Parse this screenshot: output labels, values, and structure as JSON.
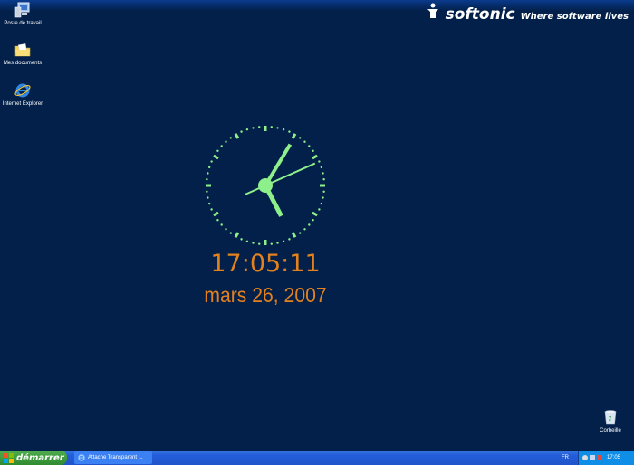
{
  "brand": {
    "name": "softonic",
    "slogan": "Where software lives"
  },
  "desktop_icons": [
    {
      "label": "Poste de travail",
      "icon": "computer-icon"
    },
    {
      "label": "Mes documents",
      "icon": "documents-folder-icon"
    },
    {
      "label": "Internet Explorer",
      "icon": "internet-explorer-icon"
    },
    {
      "label": "Corbeille",
      "icon": "recycle-bin-icon"
    }
  ],
  "clock": {
    "time": "17:05:11",
    "date": "mars 26, 2007",
    "hour": 17,
    "minute": 5,
    "second": 11,
    "face_color": "#8ef08a",
    "text_color": "#e3811e"
  },
  "taskbar": {
    "start_label": "démarrer",
    "window_button": "Attache Transparent ...",
    "language": "FR",
    "tray_time": "17:05"
  },
  "colors": {
    "desktop": "#02204a",
    "taskbar": "#245edb",
    "start": "#3c9a3c"
  }
}
